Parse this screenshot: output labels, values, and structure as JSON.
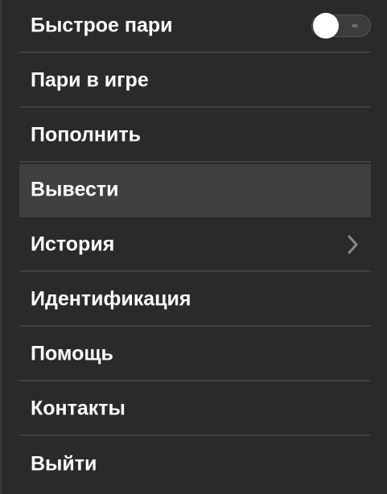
{
  "menu": {
    "quick_bet": {
      "label": "Быстрое пари",
      "toggle_on": false
    },
    "items": [
      {
        "label": "Пари в игре"
      },
      {
        "label": "Пополнить"
      },
      {
        "label": "Вывести",
        "highlighted": true
      },
      {
        "label": "История",
        "icon": "chevron-right-icon"
      },
      {
        "label": "Идентификация"
      },
      {
        "label": "Помощь"
      },
      {
        "label": "Контакты"
      },
      {
        "label": "Выйти"
      }
    ]
  },
  "colors": {
    "background": "#2a2a2a",
    "highlight": "#404040",
    "divider": "#404040",
    "text": "#ffffff"
  }
}
